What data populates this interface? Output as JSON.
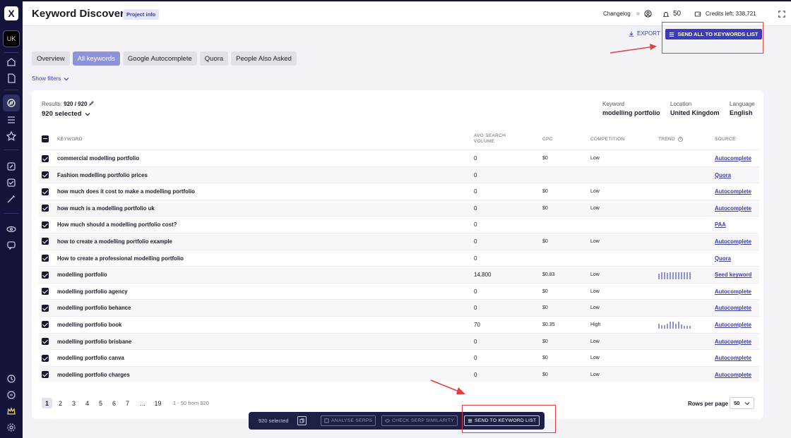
{
  "app": {
    "logo": "X",
    "workspace": "UK"
  },
  "header": {
    "title": "Keyword Discovery",
    "badge": "Project info",
    "changelog": "Changelog",
    "notifications": "50",
    "credits": "Credits left: 338,721"
  },
  "actions": {
    "export": "EXPORT",
    "send_all": "SEND ALL TO KEYWORDS LIST"
  },
  "tabs": [
    {
      "label": "Overview",
      "active": false
    },
    {
      "label": "All keywords",
      "active": true
    },
    {
      "label": "Google Autocomplete",
      "active": false
    },
    {
      "label": "Quora",
      "active": false
    },
    {
      "label": "People Also Asked",
      "active": false
    }
  ],
  "filters": {
    "label": "Show filters"
  },
  "summary": {
    "results_label": "Results:",
    "results_value": "920 / 920",
    "selected": "920 selected",
    "keyword_label": "Keyword",
    "keyword_value": "modelling portfolio",
    "location_label": "Location",
    "location_value": "United Kingdom",
    "language_label": "Language",
    "language_value": "English"
  },
  "table": {
    "columns": {
      "keyword": "KEYWORD",
      "volume": "AVG SEARCH VOLUME",
      "cpc": "CPC",
      "competition": "COMPETITION",
      "trend": "TREND",
      "source": "SOURCE"
    },
    "rows": [
      {
        "keyword": "commercial modelling portfolio",
        "volume": "0",
        "cpc": "$0",
        "competition": "Low",
        "source": "Autocomplete"
      },
      {
        "keyword": "Fashion modelling portfolio prices",
        "volume": "0",
        "cpc": "",
        "competition": "",
        "source": "Quora"
      },
      {
        "keyword": "how much does it cost to make a modelling portfolio",
        "volume": "0",
        "cpc": "$0",
        "competition": "Low",
        "source": "Autocomplete"
      },
      {
        "keyword": "how much is a modelling portfolio uk",
        "volume": "0",
        "cpc": "$0",
        "competition": "Low",
        "source": "Autocomplete"
      },
      {
        "keyword": "How much should a modelling portfolio cost?",
        "volume": "0",
        "cpc": "",
        "competition": "",
        "source": "PAA"
      },
      {
        "keyword": "how to create a modelling portfolio example",
        "volume": "0",
        "cpc": "$0",
        "competition": "Low",
        "source": "Autocomplete"
      },
      {
        "keyword": "How to create a professional modelling portfolio",
        "volume": "0",
        "cpc": "",
        "competition": "",
        "source": "Quora"
      },
      {
        "keyword": "modelling portfolio",
        "volume": "14,800",
        "cpc": "$0.83",
        "competition": "Low",
        "source": "Seed keyword",
        "trend": [
          0.7,
          0.8,
          0.8,
          0.75,
          0.8,
          0.8,
          0.8,
          0.8,
          0.8,
          0.8,
          0.8,
          0.8
        ]
      },
      {
        "keyword": "modelling portfolio agency",
        "volume": "0",
        "cpc": "$0",
        "competition": "Low",
        "source": "Autocomplete"
      },
      {
        "keyword": "modelling portfolio behance",
        "volume": "0",
        "cpc": "$0",
        "competition": "Low",
        "source": "Autocomplete"
      },
      {
        "keyword": "modelling portfolio book",
        "volume": "70",
        "cpc": "$0.35",
        "competition": "High",
        "source": "Autocomplete",
        "trend": [
          0.55,
          0.4,
          0.4,
          0.55,
          0.8,
          0.8,
          0.6,
          0.8,
          0.5,
          0.3,
          0.3,
          0.3
        ]
      },
      {
        "keyword": "modelling portfolio brisbane",
        "volume": "0",
        "cpc": "$0",
        "competition": "Low",
        "source": "Autocomplete"
      },
      {
        "keyword": "modelling portfolio canva",
        "volume": "0",
        "cpc": "$0",
        "competition": "Low",
        "source": "Autocomplete"
      },
      {
        "keyword": "modelling portfolio charges",
        "volume": "0",
        "cpc": "$0",
        "competition": "Low",
        "source": "Autocomplete"
      }
    ]
  },
  "pagination": {
    "pages": [
      "1",
      "2",
      "3",
      "4",
      "5",
      "6",
      "7",
      "...",
      "19"
    ],
    "current": "1",
    "info": "1 - 50 from 920",
    "rows_label": "Rows per page",
    "rows_value": "50"
  },
  "bulk_bar": {
    "selected": "920 selected",
    "analyse": "ANALYSE SERPS",
    "similarity": "CHECK SERP SIMILARITY",
    "send": "SEND TO KEYWORD LIST"
  },
  "colors": {
    "sidebar": "#14143a",
    "accent": "#3c3cb8",
    "active_tab": "#8e92d8",
    "annotation": "#e04040"
  }
}
